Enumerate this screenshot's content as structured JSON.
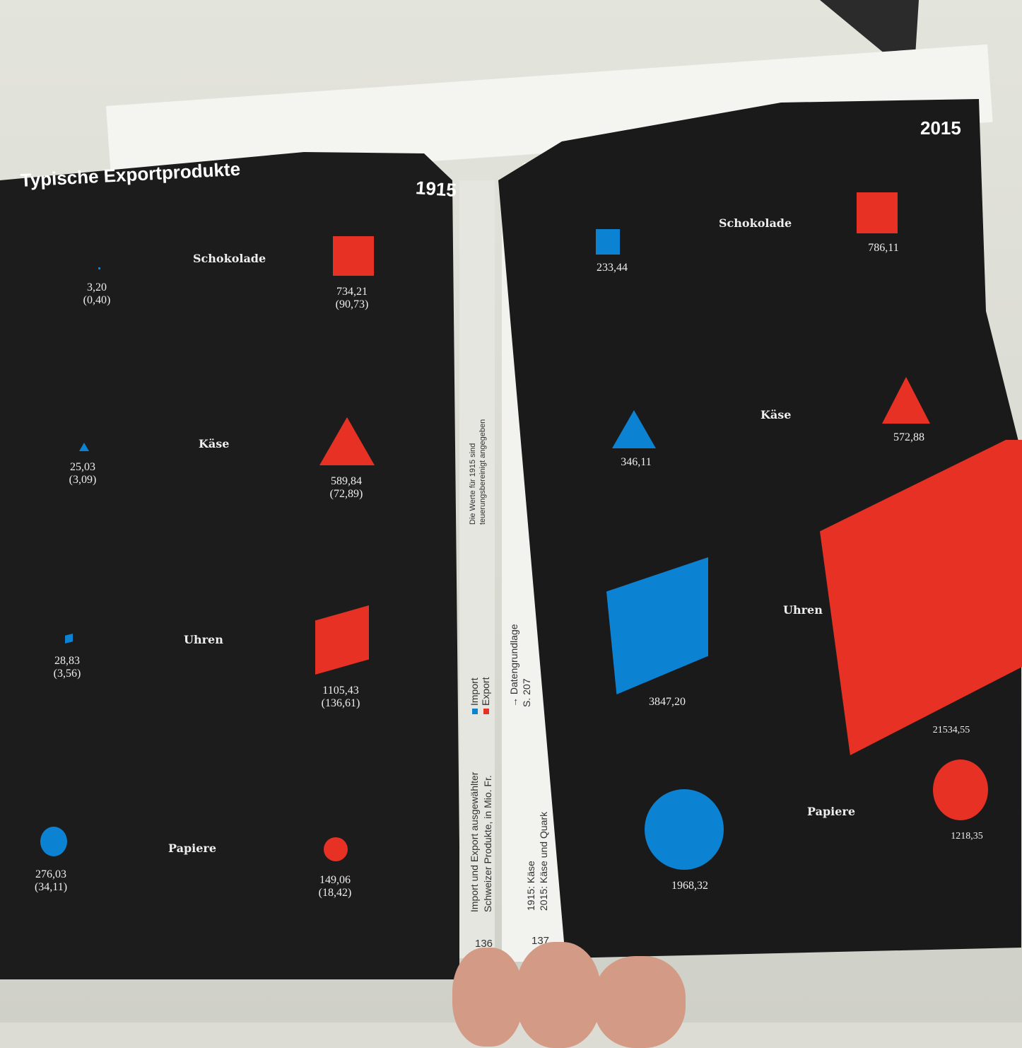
{
  "left_page": {
    "title": "Typische Exportprodukte",
    "year": "1915",
    "items": [
      {
        "name": "Schokolade",
        "import": "3,20\n(0,40)",
        "export": "734,21\n(90,73)"
      },
      {
        "name": "Käse",
        "import": "25,03\n(3,09)",
        "export": "589,84\n(72,89)"
      },
      {
        "name": "Uhren",
        "import": "28,83\n(3,56)",
        "export": "1105,43\n(136,61)"
      },
      {
        "name": "Papiere",
        "import": "276,03\n(34,11)",
        "export": "149,06\n(18,42)"
      }
    ]
  },
  "right_page": {
    "year": "2015",
    "items": [
      {
        "name": "Schokolade",
        "import": "233,44",
        "export": "786,11"
      },
      {
        "name": "Käse",
        "import": "346,11",
        "export": "572,88"
      },
      {
        "name": "Uhren",
        "import": "3847,20",
        "export": "21534,55"
      },
      {
        "name": "Papiere",
        "import": "1968,32",
        "export": "1218,35"
      }
    ]
  },
  "gutter": {
    "caption_line1": "Import und Export ausgewählter",
    "caption_line2": "Schweizer Produkte, in Mio. Fr.",
    "legend_import": "Import",
    "legend_export": "Export",
    "note_line1": "Die Werte für 1915 sind",
    "note_line2": "teuerungsbereinigt angegeben",
    "source_line1": "→ Datengrundlage",
    "source_line2": "S. 207",
    "footnote_line1": "1915: Käse",
    "footnote_line2": "2015: Käse und Quark",
    "page_left": "136",
    "page_right": "137"
  },
  "colors": {
    "import": "#0b82d2",
    "export": "#e63124",
    "page": "#1d1c1c"
  }
}
